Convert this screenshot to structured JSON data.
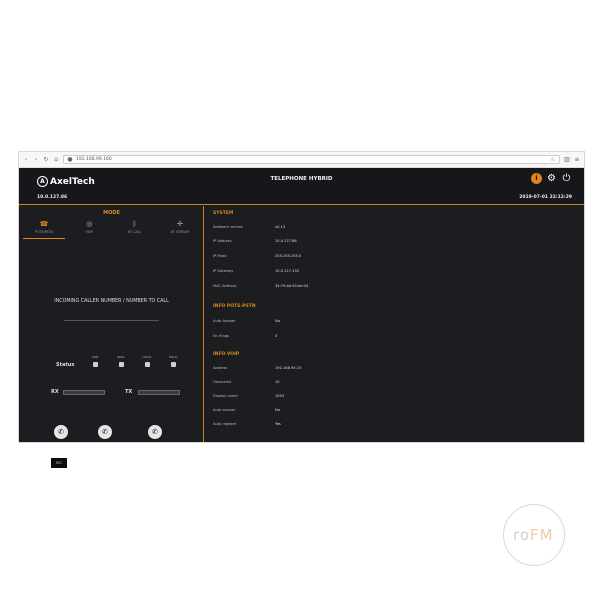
{
  "browser": {
    "url": "192.168.99.160"
  },
  "app": {
    "logo_text": "AxelTech",
    "title": "TELEPHONE HYBRID",
    "device_ip": "10.0.127.86",
    "datetime": "2019-07-01 22:12:29"
  },
  "mode": {
    "title": "MODE",
    "tabs": [
      {
        "label": "POTS/PSTN",
        "icon": "phone-icon"
      },
      {
        "label": "VOIP",
        "icon": "voip-icon"
      },
      {
        "label": "BT CALL",
        "icon": "bluetooth-icon"
      },
      {
        "label": "BT STREAM",
        "icon": "stream-icon"
      }
    ]
  },
  "left": {
    "incoming": "INCOMING CALLER NUMBER / NUMBER TO CALL",
    "status_label": "Status",
    "leds": [
      {
        "label": "LINE"
      },
      {
        "label": "RING"
      },
      {
        "label": "HOOK"
      },
      {
        "label": "HOLD"
      }
    ],
    "rx_label": "RX",
    "tx_label": "TX",
    "rx_level": 0,
    "tx_level": 0,
    "small_button": "REC"
  },
  "system": {
    "title": "SYSTEM",
    "rows": [
      {
        "k": "Software version",
        "v": "v0.13"
      },
      {
        "k": "IP Address",
        "v": "10.0.127.86"
      },
      {
        "k": "IP Mask",
        "v": "255.255.255.0"
      },
      {
        "k": "IP Gateway",
        "v": "10.0.127.130"
      },
      {
        "k": "MAC Address",
        "v": "34:79:a0:45:ee:34"
      }
    ]
  },
  "pots": {
    "title": "INFO POTS-PSTN",
    "rows": [
      {
        "k": "Auto Answer",
        "v": "No"
      },
      {
        "k": "Nr. Rings",
        "v": "3"
      }
    ]
  },
  "voip": {
    "title": "INFO VOIP",
    "rows": [
      {
        "k": "Address",
        "v": "192.168.94.15"
      },
      {
        "k": "Username",
        "v": "10"
      },
      {
        "k": "Display name",
        "v": "1003"
      },
      {
        "k": "Auto answer",
        "v": "No"
      },
      {
        "k": "Auto register",
        "v": "Yes"
      }
    ]
  },
  "watermark": {
    "text_a": "ro",
    "text_b": "FM"
  },
  "colors": {
    "accent": "#e0861a",
    "background": "#1c1d21"
  }
}
